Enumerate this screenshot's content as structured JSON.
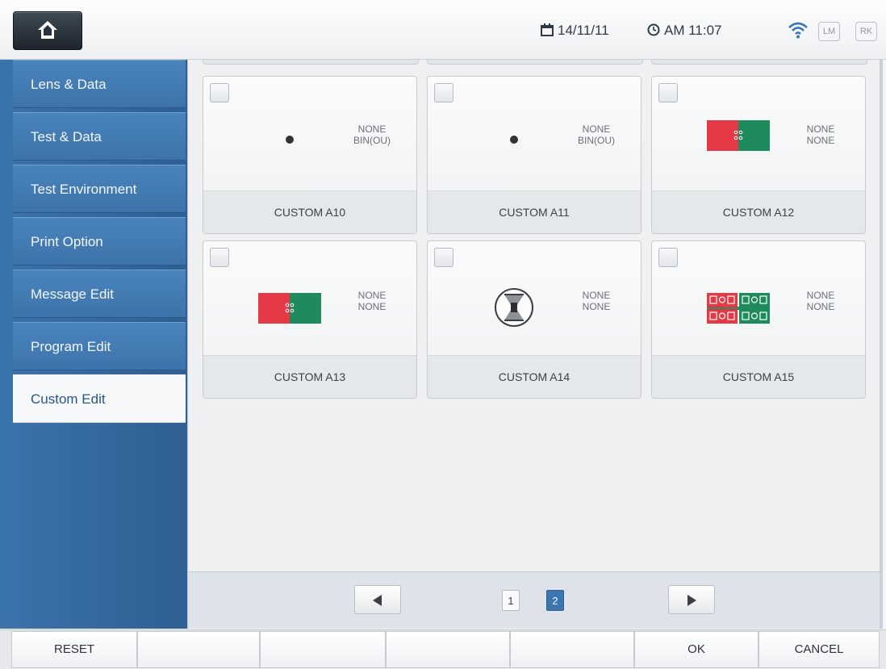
{
  "header": {
    "date": "14/11/11",
    "time": "AM 11:07",
    "badges": [
      "LM",
      "RK"
    ]
  },
  "sidebar": {
    "items": [
      {
        "label": "Lens & Data"
      },
      {
        "label": "Test & Data"
      },
      {
        "label": "Test Environment"
      },
      {
        "label": "Print Option"
      },
      {
        "label": "Message Edit"
      },
      {
        "label": "Program Edit"
      },
      {
        "label": "Custom Edit",
        "active": true
      }
    ]
  },
  "cards": [
    {
      "label": "CUSTOM A10",
      "icon": "dot-icon",
      "line1": "NONE",
      "line2": "BIN(OU)"
    },
    {
      "label": "CUSTOM A11",
      "icon": "dot-icon",
      "line1": "NONE",
      "line2": "BIN(OU)"
    },
    {
      "label": "CUSTOM A12",
      "icon": "red-green-chart-icon",
      "line1": "NONE",
      "line2": "NONE"
    },
    {
      "label": "CUSTOM A13",
      "icon": "red-green-chart-icon",
      "line1": "NONE",
      "line2": "NONE"
    },
    {
      "label": "CUSTOM A14",
      "icon": "hourglass-chart-icon",
      "line1": "NONE",
      "line2": "NONE"
    },
    {
      "label": "CUSTOM A15",
      "icon": "grid-chart-icon",
      "line1": "NONE",
      "line2": "NONE"
    }
  ],
  "pager": {
    "pages": [
      "1",
      "2"
    ],
    "current": "2",
    "prev_icon": "triangle-left-icon",
    "next_icon": "triangle-right-icon"
  },
  "footer": {
    "buttons": [
      "RESET",
      "",
      "",
      "",
      "",
      "OK",
      "CANCEL"
    ]
  },
  "colors": {
    "sidebar_blue": "#3d73aa",
    "chart_red": "#e63946",
    "chart_green": "#1f8a5b",
    "active_page": "#3b76b1"
  }
}
